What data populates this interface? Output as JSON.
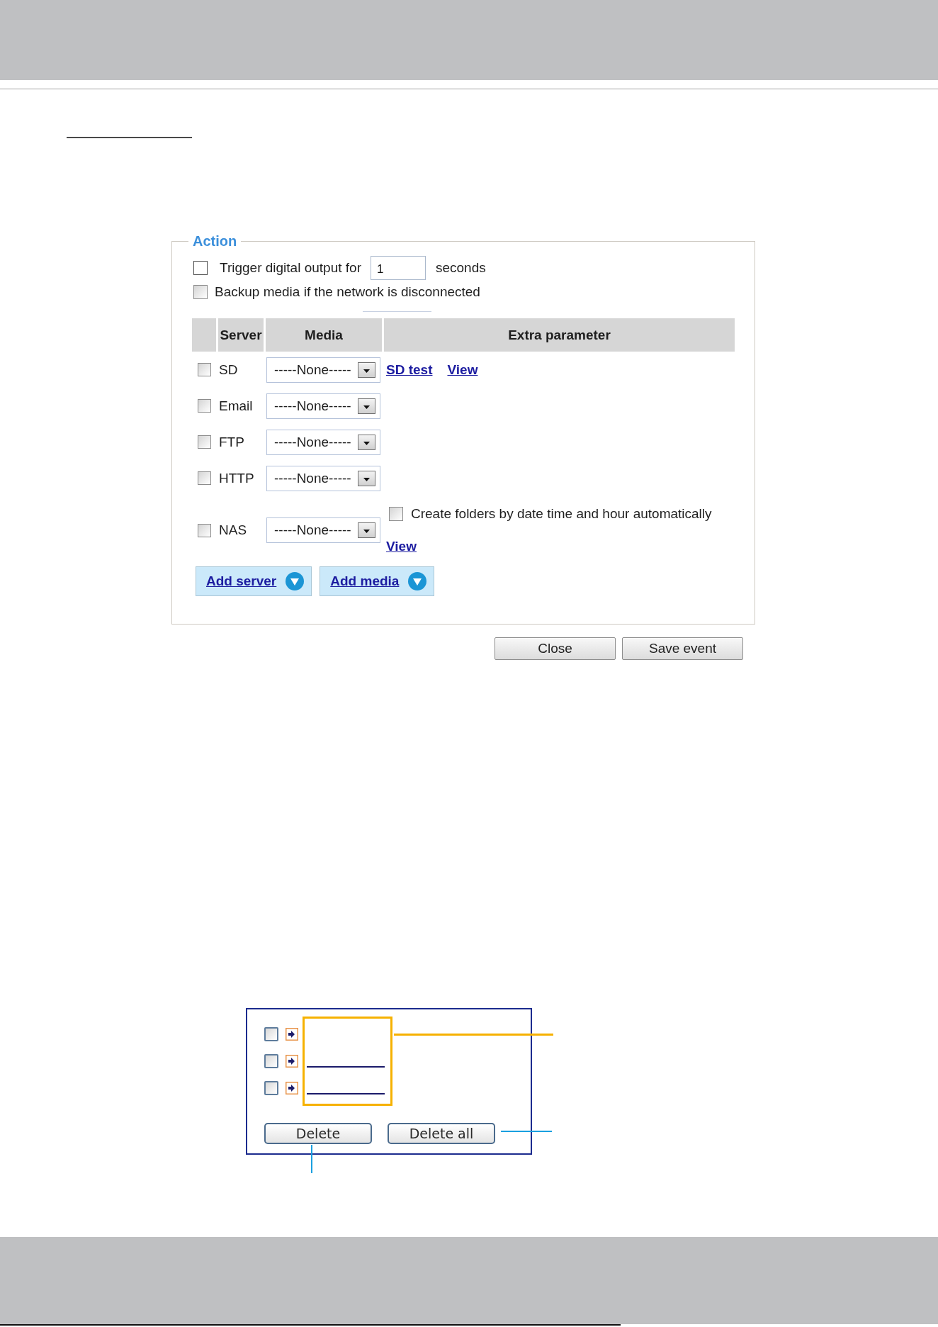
{
  "action": {
    "legend": "Action",
    "trigger_output": {
      "checked": false,
      "label": "Trigger digital output for",
      "value": "1",
      "unit": "seconds"
    },
    "backup_media": {
      "checked": false,
      "label": "Backup media if the network is disconnected"
    },
    "table": {
      "columns": [
        "Server",
        "Media",
        "Extra parameter"
      ],
      "rows": [
        {
          "checked": false,
          "server": "SD",
          "media": "-----None-----",
          "extra": [
            {
              "kind": "link",
              "label": "SD test"
            },
            {
              "kind": "link",
              "label": "View"
            }
          ]
        },
        {
          "checked": false,
          "server": "Email",
          "media": "-----None-----"
        },
        {
          "checked": false,
          "server": "FTP",
          "media": "-----None-----"
        },
        {
          "checked": false,
          "server": "HTTP",
          "media": "-----None-----"
        },
        {
          "checked": false,
          "server": "NAS",
          "media": "-----None-----",
          "extra": [
            {
              "kind": "checkbox",
              "checked": false,
              "label": "Create folders by date time and hour automatically"
            },
            {
              "kind": "link",
              "label": "View"
            }
          ]
        }
      ]
    },
    "add_buttons": [
      {
        "label": "Add server"
      },
      {
        "label": "Add media"
      }
    ]
  },
  "dialog_buttons": [
    {
      "label": "Close"
    },
    {
      "label": "Save event"
    }
  ],
  "item_list": {
    "items": [
      {
        "checked": false,
        "underlined": false
      },
      {
        "checked": false,
        "underlined": true
      },
      {
        "checked": false,
        "underlined": true
      }
    ],
    "buttons": [
      {
        "label": "Delete"
      },
      {
        "label": "Delete all"
      }
    ]
  }
}
